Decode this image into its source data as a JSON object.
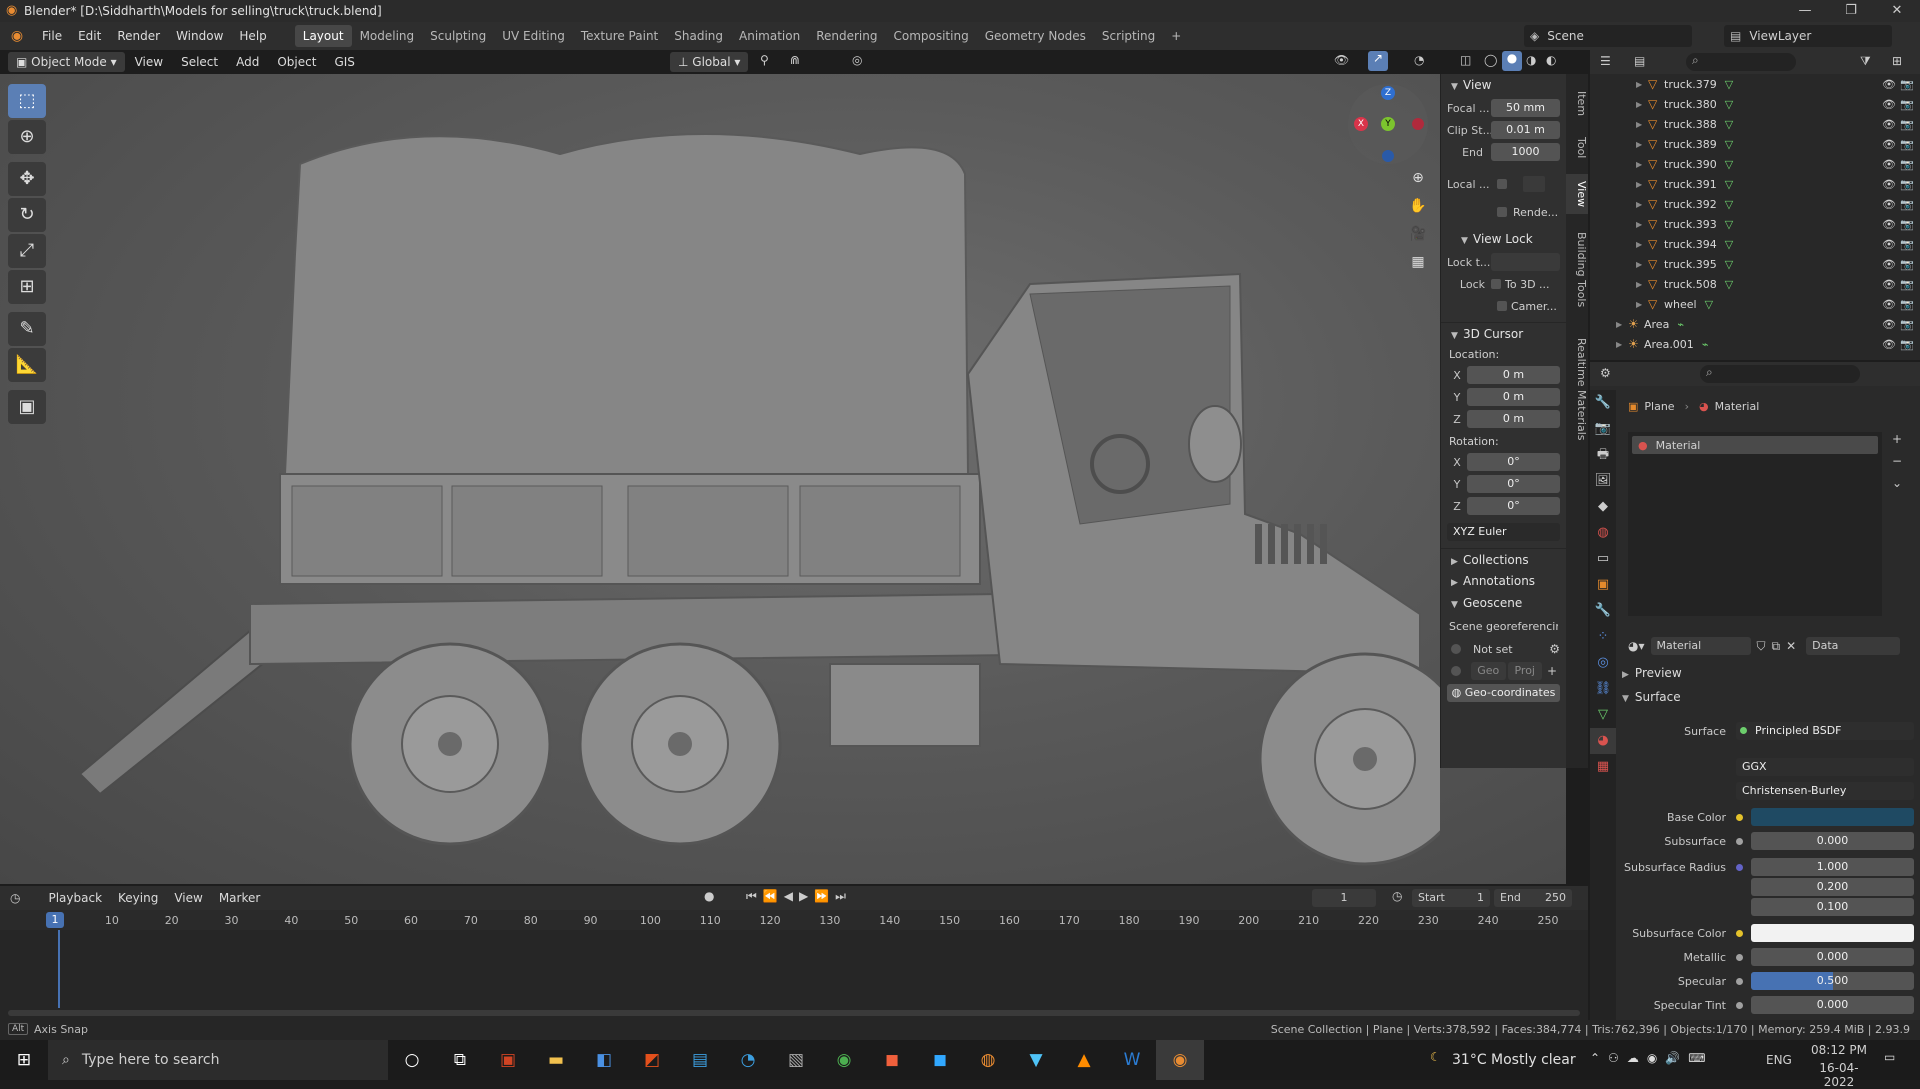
{
  "window": {
    "title": "Blender* [D:\\Siddharth\\Models for selling\\truck\\truck.blend]",
    "min": "—",
    "max": "❐",
    "close": "✕"
  },
  "menu": [
    "File",
    "Edit",
    "Render",
    "Window",
    "Help"
  ],
  "workspaces": [
    "Layout",
    "Modeling",
    "Sculpting",
    "UV Editing",
    "Texture Paint",
    "Shading",
    "Animation",
    "Rendering",
    "Compositing",
    "Geometry Nodes",
    "Scripting"
  ],
  "workspace_add": "+",
  "scene": {
    "label": "Scene",
    "viewlayer": "ViewLayer"
  },
  "viewport_header": {
    "mode": "Object Mode",
    "view": "View",
    "select": "Select",
    "add": "Add",
    "object": "Object",
    "gis": "GIS",
    "orientation": "Global"
  },
  "gizmo": {
    "x": "X",
    "y": "Y",
    "z": "Z"
  },
  "npanel": {
    "view_title": "View",
    "focal_label": "Focal ...",
    "focal_value": "50 mm",
    "clip_start_label": "Clip St...",
    "clip_start_value": "0.01 m",
    "end_label": "End",
    "end_value": "1000",
    "local_label": "Local ...",
    "render_label": "Rende...",
    "view_lock_title": "View Lock",
    "lock_to_label": "Lock t...",
    "lock_label": "Lock",
    "to3d_label": "To 3D ...",
    "camera_label": "Camer...",
    "cursor_title": "3D Cursor",
    "location_label": "Location:",
    "loc": [
      {
        "axis": "X",
        "value": "0 m"
      },
      {
        "axis": "Y",
        "value": "0 m"
      },
      {
        "axis": "Z",
        "value": "0 m"
      }
    ],
    "rotation_label": "Rotation:",
    "rot": [
      {
        "axis": "X",
        "value": "0°"
      },
      {
        "axis": "Y",
        "value": "0°"
      },
      {
        "axis": "Z",
        "value": "0°"
      }
    ],
    "rotation_mode": "XYZ Euler",
    "collections": "Collections",
    "annotations": "Annotations",
    "geoscene": "Geoscene",
    "georef": "Scene georeferencin...",
    "notset": "Not set",
    "geo": "Geo",
    "proj": "Proj",
    "geo_coords": "Geo-coordinates"
  },
  "sidetabs": [
    "Item",
    "Tool",
    "View",
    "Building Tools",
    "Realtime Materials"
  ],
  "outliner": {
    "rows": [
      {
        "name": "truck.379",
        "kind": "mesh"
      },
      {
        "name": "truck.380",
        "kind": "mesh"
      },
      {
        "name": "truck.388",
        "kind": "mesh"
      },
      {
        "name": "truck.389",
        "kind": "mesh"
      },
      {
        "name": "truck.390",
        "kind": "mesh"
      },
      {
        "name": "truck.391",
        "kind": "mesh"
      },
      {
        "name": "truck.392",
        "kind": "mesh"
      },
      {
        "name": "truck.393",
        "kind": "mesh"
      },
      {
        "name": "truck.394",
        "kind": "mesh"
      },
      {
        "name": "truck.395",
        "kind": "mesh"
      },
      {
        "name": "truck.508",
        "kind": "mesh"
      },
      {
        "name": "wheel",
        "kind": "mesh"
      },
      {
        "name": "Area",
        "kind": "light"
      },
      {
        "name": "Area.001",
        "kind": "light"
      }
    ]
  },
  "properties": {
    "object": "Plane",
    "material_tab": "Material",
    "slot": "Material",
    "mat_name": "Material",
    "data": "Data",
    "preview": "Preview",
    "surface_section": "Surface",
    "surface_label": "Surface",
    "surface_value": "Principled BSDF",
    "distribution": "GGX",
    "subsurface_method": "Christensen-Burley",
    "base_color_label": "Base Color",
    "base_color": "#1f4a63",
    "subsurface_label": "Subsurface",
    "subsurface": "0.000",
    "ss_radius_label": "Subsurface Radius",
    "ss_radius": [
      "1.000",
      "0.200",
      "0.100"
    ],
    "ss_color_label": "Subsurface Color",
    "ss_color": "#f2f2f2",
    "metallic_label": "Metallic",
    "metallic": "0.000",
    "specular_label": "Specular",
    "specular": "0.500",
    "specular_fraction": 0.5,
    "spec_tint_label": "Specular Tint",
    "spec_tint": "0.000"
  },
  "timeline": {
    "playback": "Playback",
    "keying": "Keying",
    "view": "View",
    "marker": "Marker",
    "current": "1",
    "start_label": "Start",
    "start": "1",
    "end_label": "End",
    "end": "250",
    "ticks": [
      "10",
      "20",
      "30",
      "40",
      "50",
      "60",
      "70",
      "80",
      "90",
      "100",
      "110",
      "120",
      "130",
      "140",
      "150",
      "160",
      "170",
      "180",
      "190",
      "200",
      "210",
      "220",
      "230",
      "240",
      "250"
    ],
    "frame_marker": "1"
  },
  "status": {
    "left": "Axis Snap",
    "alt": "Alt",
    "right": "Scene Collection | Plane | Verts:378,592 | Faces:384,774 | Tris:762,396 | Objects:1/170 | Memory: 259.4 MiB | 2.93.9"
  },
  "taskbar": {
    "search": "Type here to search",
    "weather": "31°C  Mostly clear",
    "lang": "ENG",
    "time": "08:12 PM",
    "date": "16-04-2022"
  }
}
